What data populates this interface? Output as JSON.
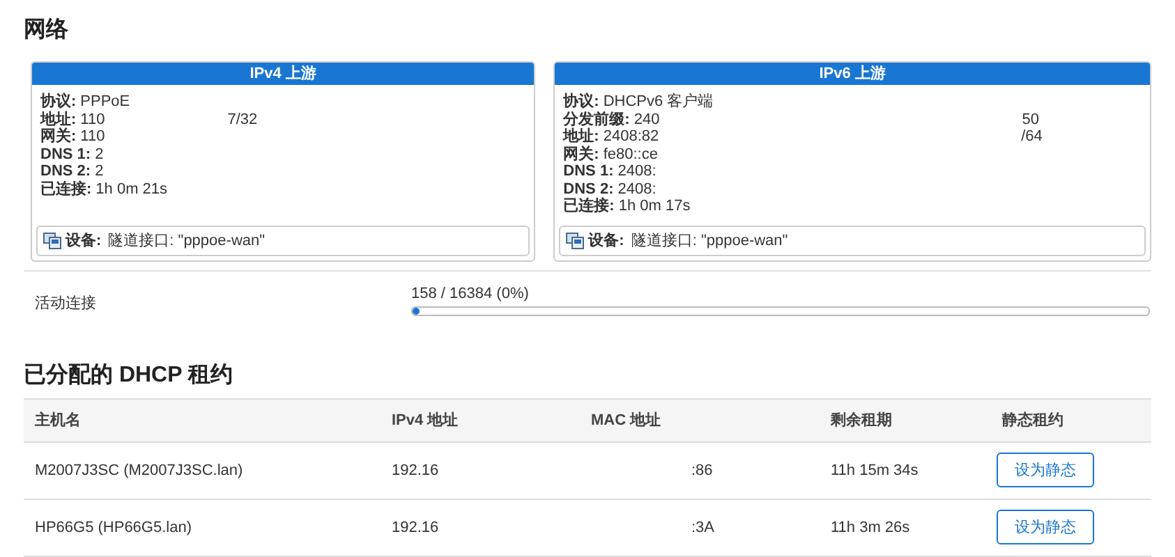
{
  "network": {
    "title": "网络",
    "upstreams": [
      {
        "title": "IPv4 上游",
        "fields": [
          {
            "label": "协议:",
            "value": "PPPoE"
          },
          {
            "label": "地址:",
            "value": "110",
            "value_end": "7/32"
          },
          {
            "label": "网关:",
            "value": "110"
          },
          {
            "label": "DNS 1:",
            "value": "2"
          },
          {
            "label": "DNS 2:",
            "value": "2"
          },
          {
            "label": "已连接:",
            "value": "1h 0m 21s"
          }
        ],
        "device": {
          "label": "设备:",
          "value": "隧道接口: \"pppoe-wan\""
        }
      },
      {
        "title": "IPv6 上游",
        "fields": [
          {
            "label": "协议:",
            "value": "DHCPv6 客户端"
          },
          {
            "label": "分发前缀:",
            "value": "240",
            "value_end": "50"
          },
          {
            "label": "地址:",
            "value": "2408:82",
            "value_end": "/64"
          },
          {
            "label": "网关:",
            "value": "fe80::ce"
          },
          {
            "label": "DNS 1:",
            "value": "2408:"
          },
          {
            "label": "DNS 2:",
            "value": "2408:"
          },
          {
            "label": "已连接:",
            "value": "1h 0m 17s"
          }
        ],
        "device": {
          "label": "设备:",
          "value": "隧道接口: \"pppoe-wan\""
        }
      }
    ],
    "connections": {
      "label": "活动连接",
      "reading": "158 / 16384 (0%)",
      "level": 0.01
    }
  },
  "dhcp": {
    "title": "已分配的 DHCP 租约",
    "columns": [
      "主机名",
      "IPv4 地址",
      "MAC 地址",
      "剩余租期",
      "静态租约"
    ],
    "rows": [
      {
        "hostname": "M2007J3SC (M2007J3SC.lan)",
        "ipv4": "192.16",
        "mac": ":86",
        "lease": "11h 15m 34s",
        "button": "设为静态"
      },
      {
        "hostname": "HP66G5 (HP66G5.lan)",
        "ipv4": "192.16",
        "mac": ":3A",
        "lease": "11h 3m 26s",
        "button": "设为静态"
      }
    ]
  }
}
